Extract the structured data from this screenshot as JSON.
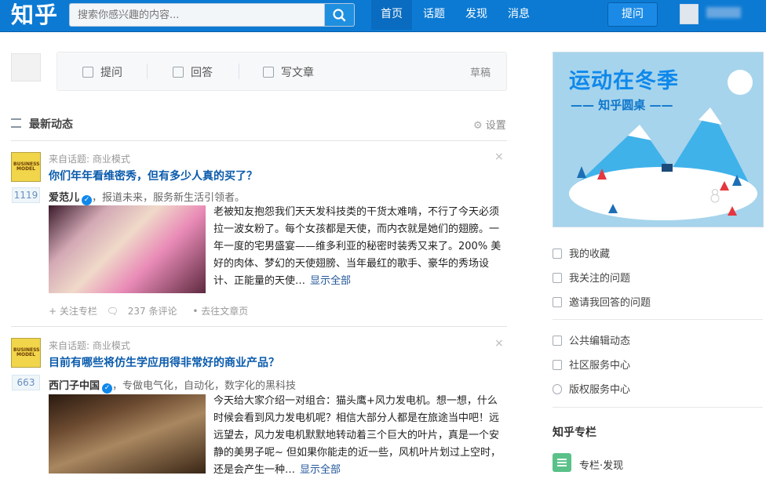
{
  "topbar": {
    "logo": "知乎",
    "search_placeholder": "搜索你感兴趣的内容...",
    "nav": [
      "首页",
      "话题",
      "发现",
      "消息"
    ],
    "ask_button": "提问",
    "brand_color": "#0c7ad3"
  },
  "composer": {
    "actions": [
      {
        "label": "提问",
        "icon": "question-icon"
      },
      {
        "label": "回答",
        "icon": "answer-icon"
      },
      {
        "label": "写文章",
        "icon": "edit-icon"
      }
    ],
    "drafts": "草稿"
  },
  "feed": {
    "title": "最新动态",
    "settings": "设置",
    "items": [
      {
        "source": "来自话题: 商业模式",
        "thumb_text": "BUSINESS MODEL",
        "votes": "1119",
        "title": "你们年年看维密秀，但有多少人真的买了？",
        "author": "爱范儿",
        "bio": "，报道未来，服务新生活引领者。",
        "excerpt": "老被知友抱怨我们天天发科技类的干货太难啃，不行了今天必须拉一波女粉了。每个女孩都是天使，而内衣就是她们的翅膀。一年一度的宅男盛宴——维多利亚的秘密时装秀又来了。200% 美好的肉体、梦幻的天使翅膀、当年最红的歌手、豪华的秀场设计、正能量的天使…",
        "more": "显示全部",
        "meta": [
          "+ 关注专栏",
          "237 条评论",
          "• 去往文章页"
        ]
      },
      {
        "source": "来自话题: 商业模式",
        "thumb_text": "BUSINESS MODEL",
        "votes": "663",
        "title": "目前有哪些将仿生学应用得非常好的商业产品？",
        "author": "西门子中国",
        "bio": "，专做电气化，自动化，数字化的黑科技",
        "excerpt": "今天给大家介绍一对组合：猫头鹰+风力发电机。想一想，什么时候会看到风力发电机呢？相信大部分人都是在旅途当中吧！远远望去，风力发电机默默地转动着三个巨大的叶片，真是一个安静的美男子呢~ 但如果你能走的近一些，风机叶片划过上空时，还是会产生一种…",
        "more": "显示全部"
      }
    ]
  },
  "sidebar": {
    "banner_title": "运动在冬季",
    "banner_subtitle": "—— 知乎圆桌 ——",
    "links_group1": [
      {
        "label": "我的收藏",
        "icon": "bookmark-icon"
      },
      {
        "label": "我关注的问题",
        "icon": "checkbox-icon"
      },
      {
        "label": "邀请我回答的问题",
        "icon": "document-icon"
      }
    ],
    "links_group2": [
      {
        "label": "公共编辑动态",
        "icon": "list-icon"
      },
      {
        "label": "社区服务中心",
        "icon": "home-icon"
      },
      {
        "label": "版权服务中心",
        "icon": "copyright-icon"
      }
    ],
    "column_title": "知乎专栏",
    "column_link": "专栏·发现"
  }
}
